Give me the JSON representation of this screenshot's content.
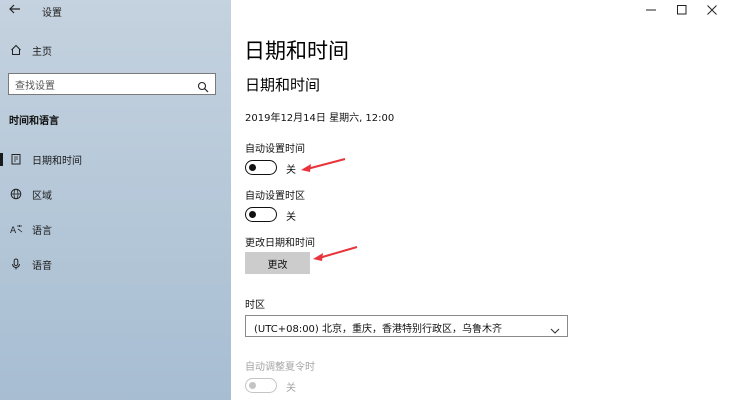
{
  "app": {
    "title": "设置",
    "back_icon": "back-arrow-icon"
  },
  "window_controls": {
    "minimize": "minimize-icon",
    "maximize": "maximize-icon",
    "close": "close-icon"
  },
  "sidebar": {
    "home_label": "主页",
    "search_placeholder": "查找设置",
    "section_heading": "时间和语言",
    "items": [
      {
        "label": "日期和时间",
        "icon": "calendar-icon",
        "active": true
      },
      {
        "label": "区域",
        "icon": "globe-icon",
        "active": false
      },
      {
        "label": "语言",
        "icon": "language-icon",
        "active": false
      },
      {
        "label": "语音",
        "icon": "microphone-icon",
        "active": false
      }
    ]
  },
  "main": {
    "page_title": "日期和时间",
    "sub_title": "日期和时间",
    "current_datetime": "2019年12月14日 星期六, 12:00",
    "auto_time": {
      "label": "自动设置时间",
      "state": "关",
      "on": false
    },
    "auto_timezone": {
      "label": "自动设置时区",
      "state": "关",
      "on": false
    },
    "change_datetime": {
      "label": "更改日期和时间",
      "button": "更改"
    },
    "timezone": {
      "label": "时区",
      "value": "(UTC+08:00) 北京，重庆，香港特别行政区，乌鲁木齐"
    },
    "dst": {
      "label": "自动调整夏令时",
      "state": "关",
      "on": false,
      "disabled": true
    }
  },
  "colors": {
    "sidebar_bg": "#b4c7d8",
    "annotation_arrow": "#e8343a",
    "button_bg": "#cccccc"
  }
}
